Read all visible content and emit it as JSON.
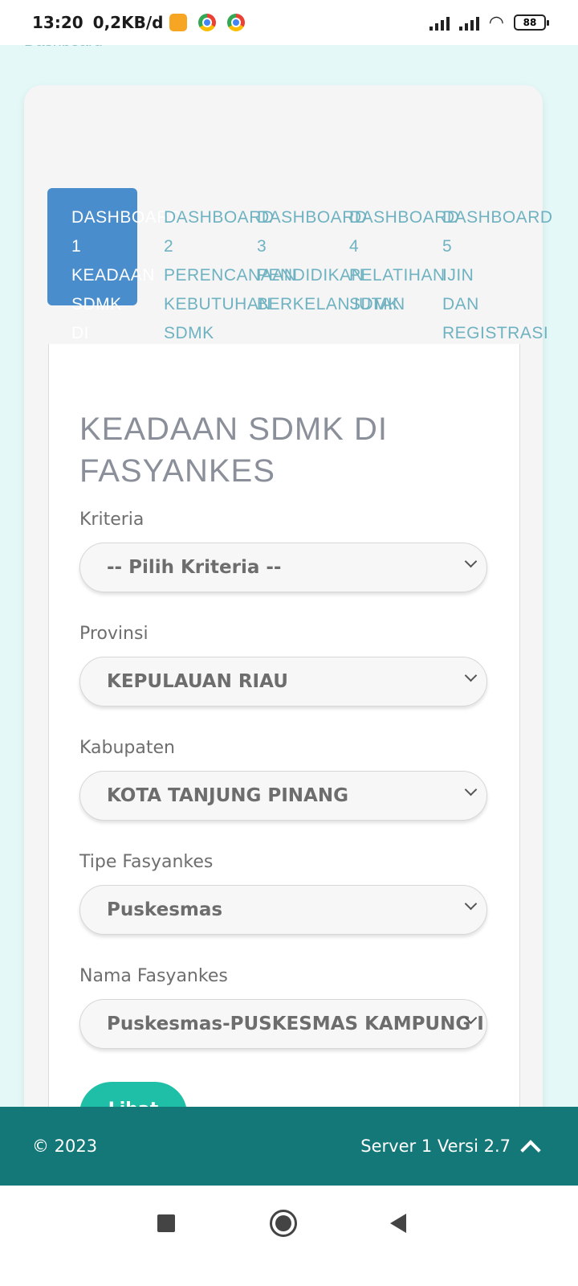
{
  "status_bar": {
    "time": "13:20",
    "speed": "0,2KB/d",
    "battery": "88"
  },
  "breadcrumb": "Dashboard",
  "tabs": [
    {
      "lines": [
        "DASHBOARD",
        "1",
        "KEADAAN",
        "SDMK",
        "DI"
      ],
      "active": true
    },
    {
      "lines": [
        "DASHBOARD",
        "2",
        "PERENCANAAN",
        "KEBUTUHAN",
        "SDMK"
      ],
      "active": false
    },
    {
      "lines": [
        "DASHBOARD",
        "3",
        "PENDIDIKAN",
        "BERKELANJUTAN"
      ],
      "active": false
    },
    {
      "lines": [
        "DASHBOARD",
        "4",
        "PELATIHAN",
        "SDMK"
      ],
      "active": false
    },
    {
      "lines": [
        "DASHBOARD",
        "5",
        "IJIN",
        "DAN",
        "REGISTRASI"
      ],
      "active": false
    }
  ],
  "form": {
    "title": "KEADAAN SDMK DI FASYANKES",
    "fields": [
      {
        "label": "Kriteria",
        "value": "-- Pilih Kriteria --"
      },
      {
        "label": "Provinsi",
        "value": "KEPULAUAN RIAU"
      },
      {
        "label": "Kabupaten",
        "value": "KOTA TANJUNG PINANG"
      },
      {
        "label": "Tipe Fasyankes",
        "value": "Puskesmas"
      },
      {
        "label": "Nama Fasyankes",
        "value": "Puskesmas-PUSKESMAS KAMPUNG I"
      }
    ],
    "submit_label": "Lihat"
  },
  "footer": {
    "copyright": "© 2023",
    "server": "Server 1 Versi 2.7"
  },
  "icons": {
    "up": "chevron-up-icon",
    "recents": "square-icon",
    "home": "circle-icon",
    "back": "triangle-back-icon"
  }
}
